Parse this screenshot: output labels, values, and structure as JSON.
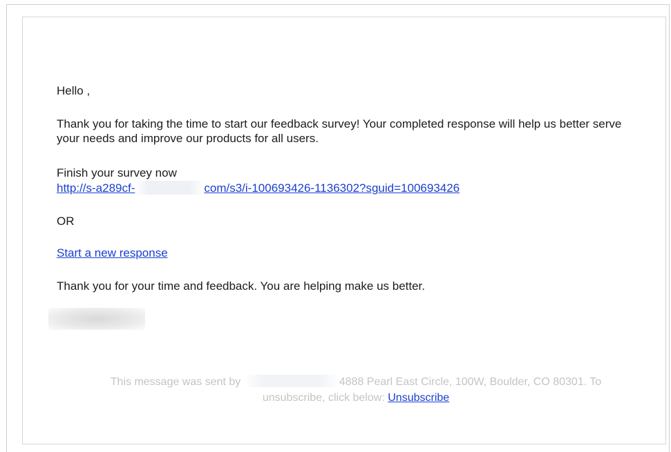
{
  "email": {
    "greeting": "Hello ,",
    "intro": "Thank you for taking the time to start our feedback survey! Your completed response will help us better serve your needs and improve our products for all users.",
    "finish_label": "Finish your survey now",
    "survey_link_prefix": "http://s-a289cf-",
    "survey_link_suffix": "com/s3/i-100693426-1136302?sguid=100693426",
    "or_text": "OR",
    "new_response_link": "Start a new response",
    "thanks": "Thank you for your time and feedback. You are helping make us better."
  },
  "footer": {
    "sent_by_prefix": "This message was sent by",
    "address": "4888 Pearl East Circle, 100W, Boulder, CO 80301. To",
    "unsubscribe_prefix": "unsubscribe, click below:",
    "unsubscribe_link": "Unsubscribe"
  },
  "colors": {
    "link": "#1a3fcf",
    "body_text": "#1c1c1c",
    "footer_text": "#c4c4c4"
  }
}
